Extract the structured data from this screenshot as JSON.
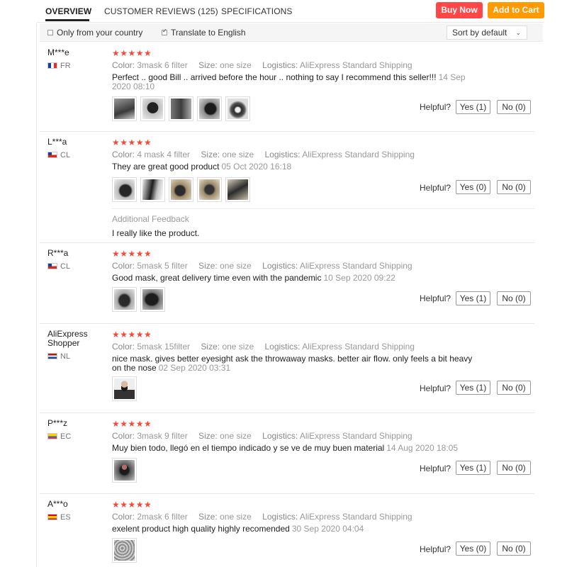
{
  "tabs": {
    "overview": "OVERVIEW",
    "reviews": "CUSTOMER REVIEWS (125)",
    "specifications": "SPECIFICATIONS"
  },
  "actions": {
    "buy_now": "Buy Now",
    "add_to_cart": "Add to Cart"
  },
  "filters": {
    "only_country": "Only from your country",
    "translate": "Translate to English",
    "sort": "Sort by default"
  },
  "labels": {
    "color": "Color:",
    "size": "Size:",
    "logistics": "Logistics:",
    "helpful": "Helpful?",
    "stars": "★★★★★",
    "additional_feedback": "Additional Feedback"
  },
  "colors": {
    "buy_now": "#ff4747",
    "add_to_cart": "#ff9a00",
    "stars": "#f24b3d"
  },
  "reviews": [
    {
      "name": "M***e",
      "country": "FR",
      "color": "3mask 6 filter",
      "size": "one size",
      "logistics": "AliExpress Standard Shipping",
      "text": "Perfect .. good Bill .. arrived before the hour .. nothing to say I recommend this seller!!!",
      "date": "14 Sep 2020 08:10",
      "yes": "Yes (1)",
      "no": "No (0)"
    },
    {
      "name": "L***a",
      "country": "CL",
      "color": "4 mask 4 filter",
      "size": "one size",
      "logistics": "AliExpress Standard Shipping",
      "text": "They are great good product",
      "date": "05 Oct 2020 16:18",
      "yes": "Yes (0)",
      "no": "No (0)",
      "additional": "I really like the product."
    },
    {
      "name": "R***a",
      "country": "CL",
      "color": "5mask 5 filter",
      "size": "one size",
      "logistics": "AliExpress Standard Shipping",
      "text": "Good mask, great delivery time even with the pandemic",
      "date": "10 Sep 2020 09:22",
      "yes": "Yes (1)",
      "no": "No (0)"
    },
    {
      "name": "AliExpress Shopper",
      "country": "NL",
      "color": "5mask 15filter",
      "size": "one size",
      "logistics": "AliExpress Standard Shipping",
      "text": "nice mask. gives better eyesight ask the throwaway masks. better air flow. only feels a bit heavy on the nose",
      "date": "02 Sep 2020 03:31",
      "yes": "Yes (1)",
      "no": "No (0)"
    },
    {
      "name": "P***z",
      "country": "EC",
      "color": "3mask 9 filter",
      "size": "one size",
      "logistics": "AliExpress Standard Shipping",
      "text": "Muy bien todo, llegó en el tiempo indicado y se ve de muy buen material",
      "date": "14 Aug 2020 18:05",
      "yes": "Yes (1)",
      "no": "No (0)"
    },
    {
      "name": "A***o",
      "country": "ES",
      "color": "2mask 6 filter",
      "size": "one size",
      "logistics": "AliExpress Standard Shipping",
      "text": "exelent product high quality highly recomended",
      "date": "30 Sep 2020 04:04",
      "yes": "Yes (0)",
      "no": "No (0)"
    }
  ]
}
